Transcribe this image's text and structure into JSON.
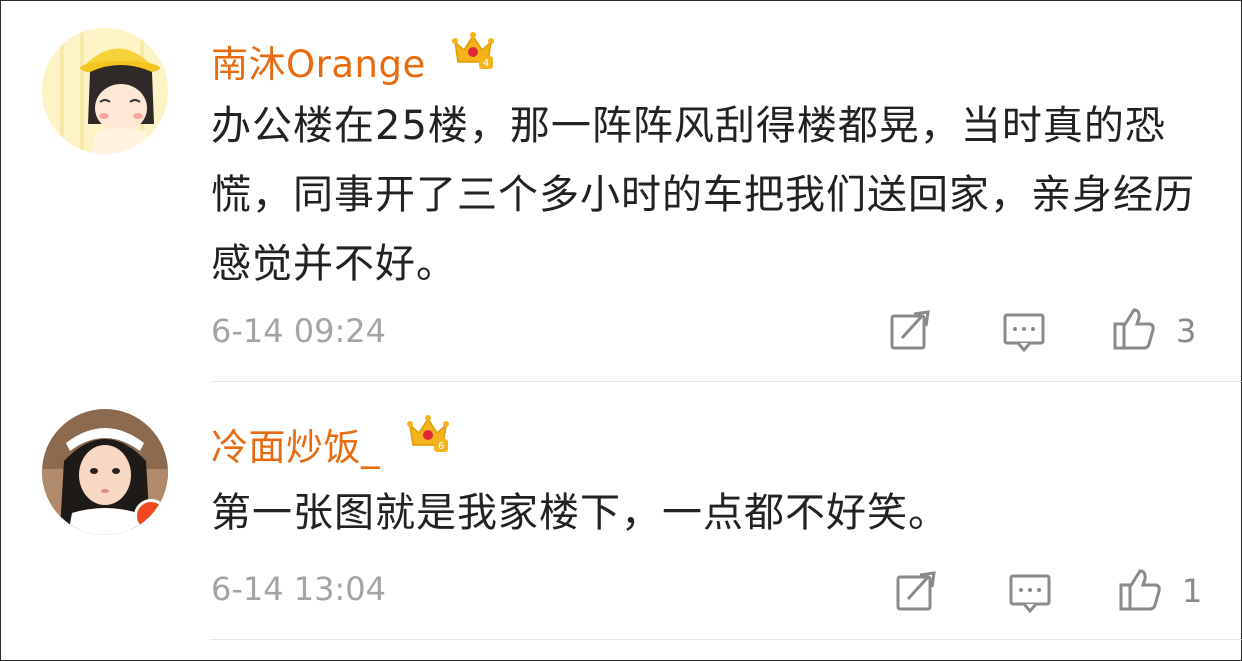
{
  "comments": [
    {
      "username": "南沐Orange",
      "crown_level": "4",
      "text": "办公楼在25楼，那一阵阵风刮得楼都晃，当时真的恐慌，同事开了三个多小时的车把我们送回家，亲身经历感觉并不好。",
      "time": "6-14 09:24",
      "likes": "3",
      "icons": [
        "repost-icon",
        "comment-icon",
        "like-icon"
      ]
    },
    {
      "username": "冷面炒饭_",
      "crown_level": "6",
      "text": "第一张图就是我家楼下，一点都不好笑。",
      "time": "6-14 13:04",
      "likes": "1",
      "icons": [
        "repost-icon",
        "comment-icon",
        "like-icon"
      ]
    }
  ],
  "colors": {
    "username": "#e86b0f",
    "body_text": "#222222",
    "meta_text": "#a4a4a4",
    "crown": "#f3b31b",
    "verified_badge": "#f0481f",
    "divider": "#e6e6e6"
  }
}
